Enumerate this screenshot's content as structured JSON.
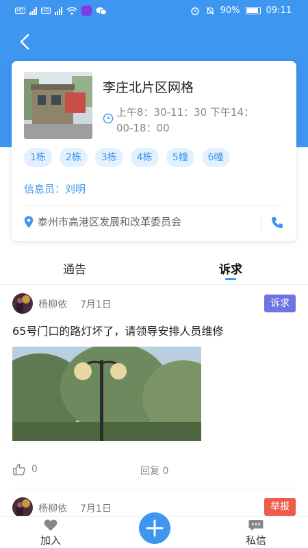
{
  "status_bar": {
    "battery": "90%",
    "time": "09:11"
  },
  "grid": {
    "title": "李庄北片区网格",
    "hours": "上午8：30-11：30  下午14：00-18：00",
    "tags": [
      "1栋",
      "2栋",
      "3栋",
      "4栋",
      "5幢",
      "6幢"
    ],
    "info_label": "信息员：",
    "info_name": "刘明",
    "address": "泰州市高港区发展和改革委员会"
  },
  "tabs": {
    "notice": "通告",
    "appeal": "诉求",
    "active": "appeal"
  },
  "posts": [
    {
      "author": "杨柳依",
      "date": "7月1日",
      "badge": "诉求",
      "text": "65号门口的路灯坏了，请领导安排人员维修",
      "likes": "0",
      "replies": "回复 0"
    },
    {
      "author": "杨柳依",
      "date": "7月1日",
      "badge": "举报"
    }
  ],
  "bottom_nav": {
    "join": "加入",
    "message": "私信"
  },
  "colors": {
    "primary": "#3d96f0",
    "appeal_badge": "#6f74e3",
    "report_badge": "#ee5b4a"
  }
}
